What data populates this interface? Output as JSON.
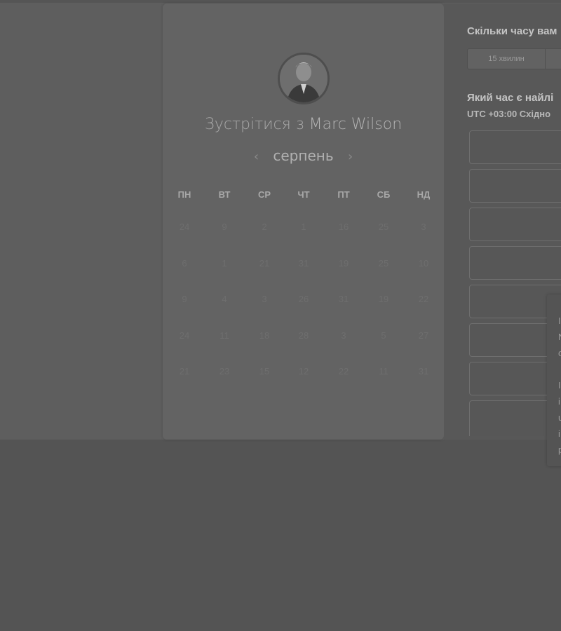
{
  "meeting": {
    "title_prefix": "Зустрітися з",
    "host_name": "Marc Wilson"
  },
  "calendar": {
    "month": "серпень",
    "prev_arrow": "‹",
    "next_arrow": "›",
    "weekdays": [
      "ПН",
      "ВТ",
      "СР",
      "ЧТ",
      "ПТ",
      "СБ",
      "НД"
    ],
    "weeks": [
      [
        "24",
        "9",
        "2",
        "1",
        "16",
        "25",
        "3"
      ],
      [
        "6",
        "1",
        "21",
        "31",
        "19",
        "25",
        "10"
      ],
      [
        "9",
        "4",
        "3",
        "26",
        "31",
        "19",
        "22"
      ],
      [
        "24",
        "11",
        "18",
        "28",
        "3",
        "5",
        "27"
      ],
      [
        "21",
        "23",
        "15",
        "12",
        "22",
        "11",
        "31"
      ]
    ]
  },
  "right_panel": {
    "duration_question": "Скільки часу вам",
    "duration_options": [
      "15 хвилин"
    ],
    "time_question": "Який час є найлі",
    "timezone": "UTC +03:00 Східно",
    "slot_count": 8
  },
  "popover": {
    "lines_group1": [
      "I",
      "N",
      "c"
    ],
    "lines_group2": [
      "I",
      "i",
      "u",
      "i",
      "p"
    ]
  }
}
